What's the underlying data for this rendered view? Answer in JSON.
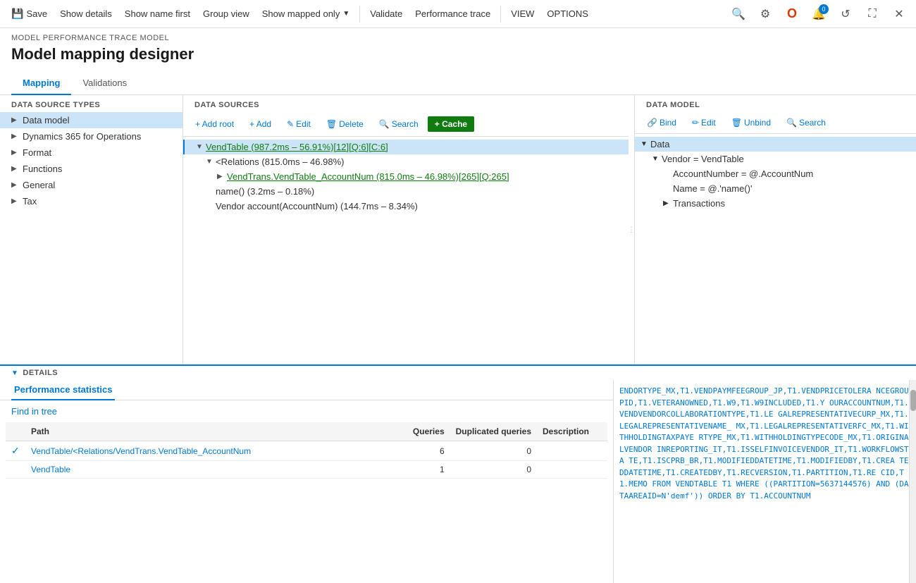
{
  "toolbar": {
    "save_label": "Save",
    "show_details_label": "Show details",
    "show_name_label": "Show name first",
    "group_view_label": "Group view",
    "show_mapped_label": "Show mapped only",
    "validate_label": "Validate",
    "perf_trace_label": "Performance trace",
    "view_label": "VIEW",
    "options_label": "OPTIONS"
  },
  "page": {
    "breadcrumb": "MODEL PERFORMANCE TRACE MODEL",
    "title": "Model mapping designer"
  },
  "tabs": {
    "mapping": "Mapping",
    "validations": "Validations"
  },
  "data_source_types": {
    "label": "DATA SOURCE TYPES",
    "items": [
      {
        "label": "Data model",
        "selected": true
      },
      {
        "label": "Dynamics 365 for Operations",
        "selected": false
      },
      {
        "label": "Format",
        "selected": false
      },
      {
        "label": "Functions",
        "selected": false
      },
      {
        "label": "General",
        "selected": false
      },
      {
        "label": "Tax",
        "selected": false
      }
    ]
  },
  "data_sources": {
    "label": "DATA SOURCES",
    "toolbar": {
      "add_root": "+ Add root",
      "add": "+ Add",
      "edit": "✎ Edit",
      "delete": "🗑 Delete",
      "search": "🔍 Search",
      "cache": "+ Cache"
    },
    "tree": [
      {
        "level": 0,
        "text": "VendTable (987.2ms - 56.91%)[12][Q:6][C:6]",
        "expanded": true,
        "selected": true,
        "green": true
      },
      {
        "level": 1,
        "text": "<Relations (815.0ms - 46.98%)",
        "expanded": true
      },
      {
        "level": 2,
        "text": "VendTrans.VendTable_AccountNum (815.0ms - 46.98%)[265][Q:265]",
        "expanded": false,
        "green": true
      },
      {
        "level": 1,
        "text": "name() (3.2ms - 0.18%)",
        "expanded": false
      },
      {
        "level": 1,
        "text": "Vendor account(AccountNum) (144.7ms - 8.34%)",
        "expanded": false
      }
    ]
  },
  "data_model": {
    "label": "DATA MODEL",
    "toolbar": {
      "bind": "Bind",
      "edit": "Edit",
      "unbind": "Unbind",
      "search": "Search"
    },
    "tree": [
      {
        "level": 0,
        "text": "Data",
        "expanded": true,
        "selected": true
      },
      {
        "level": 1,
        "text": "Vendor = VendTable",
        "expanded": true
      },
      {
        "level": 2,
        "text": "AccountNumber = @.AccountNum",
        "expanded": false
      },
      {
        "level": 2,
        "text": "Name = @.'name()'",
        "expanded": false
      },
      {
        "level": 2,
        "text": "Transactions",
        "expanded": false,
        "has_chevron": true
      }
    ]
  },
  "details": {
    "section_label": "DETAILS",
    "tab_label": "Performance statistics",
    "find_in_tree": "Find in tree",
    "table": {
      "headers": [
        "",
        "Path",
        "Queries",
        "Duplicated queries",
        "Description"
      ],
      "rows": [
        {
          "check": true,
          "path": "VendTable/<Relations/VendTrans.VendTable_AccountNum",
          "queries": "6",
          "dup_queries": "0",
          "description": ""
        },
        {
          "check": false,
          "path": "VendTable",
          "queries": "1",
          "dup_queries": "0",
          "description": ""
        }
      ]
    },
    "sql_text": "ENDORTYPE_MX,T1.VENDPAYMFEEGROUP_JP,T1.VENDPRICETOLERA NCEGROUPID,T1.VETERANOWNED,T1.W9,T1.W9INCLUDED,T1.Y OURACCOUNTNUM,T1.VENDVENDORCOLLABORATIONTYPE,T1.LE GALREPRESENTATIVECURP_MX,T1.LEGALREPRESENTATIVENAME_ MX,T1.LEGALREPRESENTATIVERFC_MX,T1.WITHHOLDINGTAXPAYE RTYPE_MX,T1.WITHHOLDINGTYPECODE_MX,T1.ORIGINALVENDOR INREPORTING_IT,T1.ISSELFINVOICEVENDOR_IT,T1.WORKFLOWSTA TE,T1.ISCPRB_BR,T1.MODIFIEDDATETIME,T1.MODIFIEDBY,T1.CREA TEDDATETIME,T1.CREATEDBY,T1.RECVERSION,T1.PARTITION,T1.RE CID,T1.MEMO FROM VENDTABLE T1 WHERE ((PARTITION=5637144576) AND (DATAAREAID=N'demf')) ORDER BY T1.ACCOUNTNUM"
  },
  "icons": {
    "save": "💾",
    "search": "🔍",
    "refresh": "↺",
    "close": "✕",
    "expand": "⊞",
    "settings": "⚙",
    "office": "O",
    "notification": "🔔",
    "fullscreen": "⛶",
    "chevron_right": "▶",
    "chevron_down": "▼",
    "chevron_small_right": "›",
    "bind_icon": "🔗",
    "edit_icon": "✏",
    "unbind_icon": "🗑",
    "search_icon": "🔍"
  }
}
